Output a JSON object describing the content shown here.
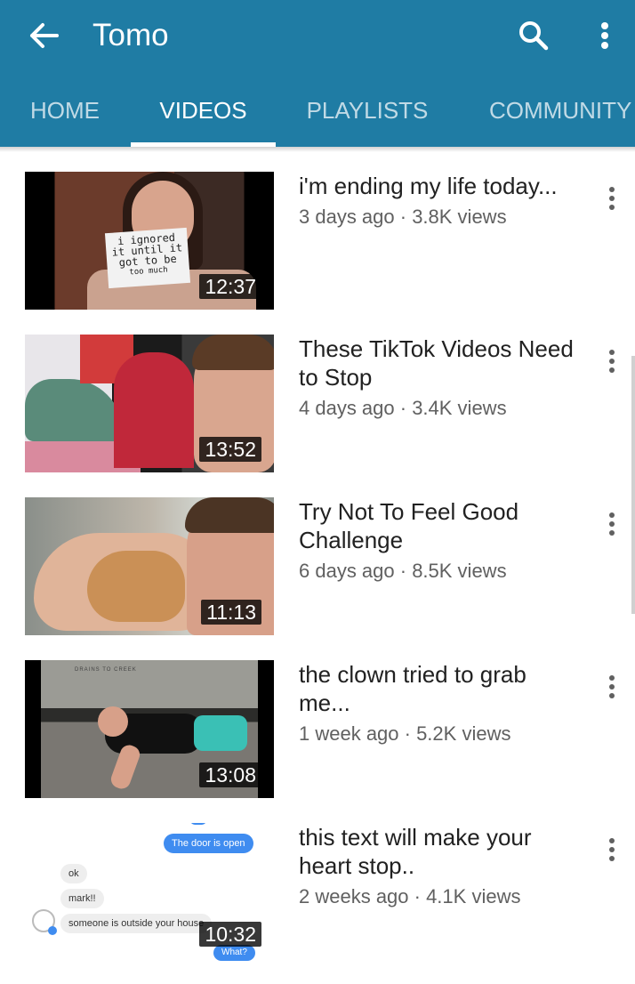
{
  "header": {
    "title": "Tomo",
    "background_color": "#1f7ca4",
    "back_icon": "arrow-left-icon",
    "search_icon": "search-icon",
    "more_icon": "more-vert-icon"
  },
  "tabs": [
    {
      "label": "HOME",
      "active": false
    },
    {
      "label": "VIDEOS",
      "active": true
    },
    {
      "label": "PLAYLISTS",
      "active": false
    },
    {
      "label": "COMMUNITY",
      "active": false
    }
  ],
  "videos": [
    {
      "title": "i'm ending my life today...",
      "meta": "3 days ago · 3.8K views",
      "duration": "12:37",
      "thumb_text": [
        "i ignored",
        "it until it",
        "got to be",
        "too much"
      ]
    },
    {
      "title": "These TikTok Videos Need to Stop",
      "meta": "4 days ago · 3.4K views",
      "duration": "13:52"
    },
    {
      "title": "Try Not To Feel Good Challenge",
      "meta": "6 days ago · 8.5K views",
      "duration": "11:13"
    },
    {
      "title": "the clown tried to grab me...",
      "meta": "1 week ago · 5.2K views",
      "duration": "13:08",
      "thumb_text": [
        "DRAINS TO CREEK"
      ]
    },
    {
      "title": "this text will make your heart stop..",
      "meta": "2 weeks ago · 4.1K views",
      "duration": "10:32",
      "chat": {
        "sent_1": "The door is open",
        "recv_1": "ok",
        "recv_2": "mark!!",
        "recv_3": "someone is outside your house",
        "sent_2": "What?"
      }
    }
  ]
}
